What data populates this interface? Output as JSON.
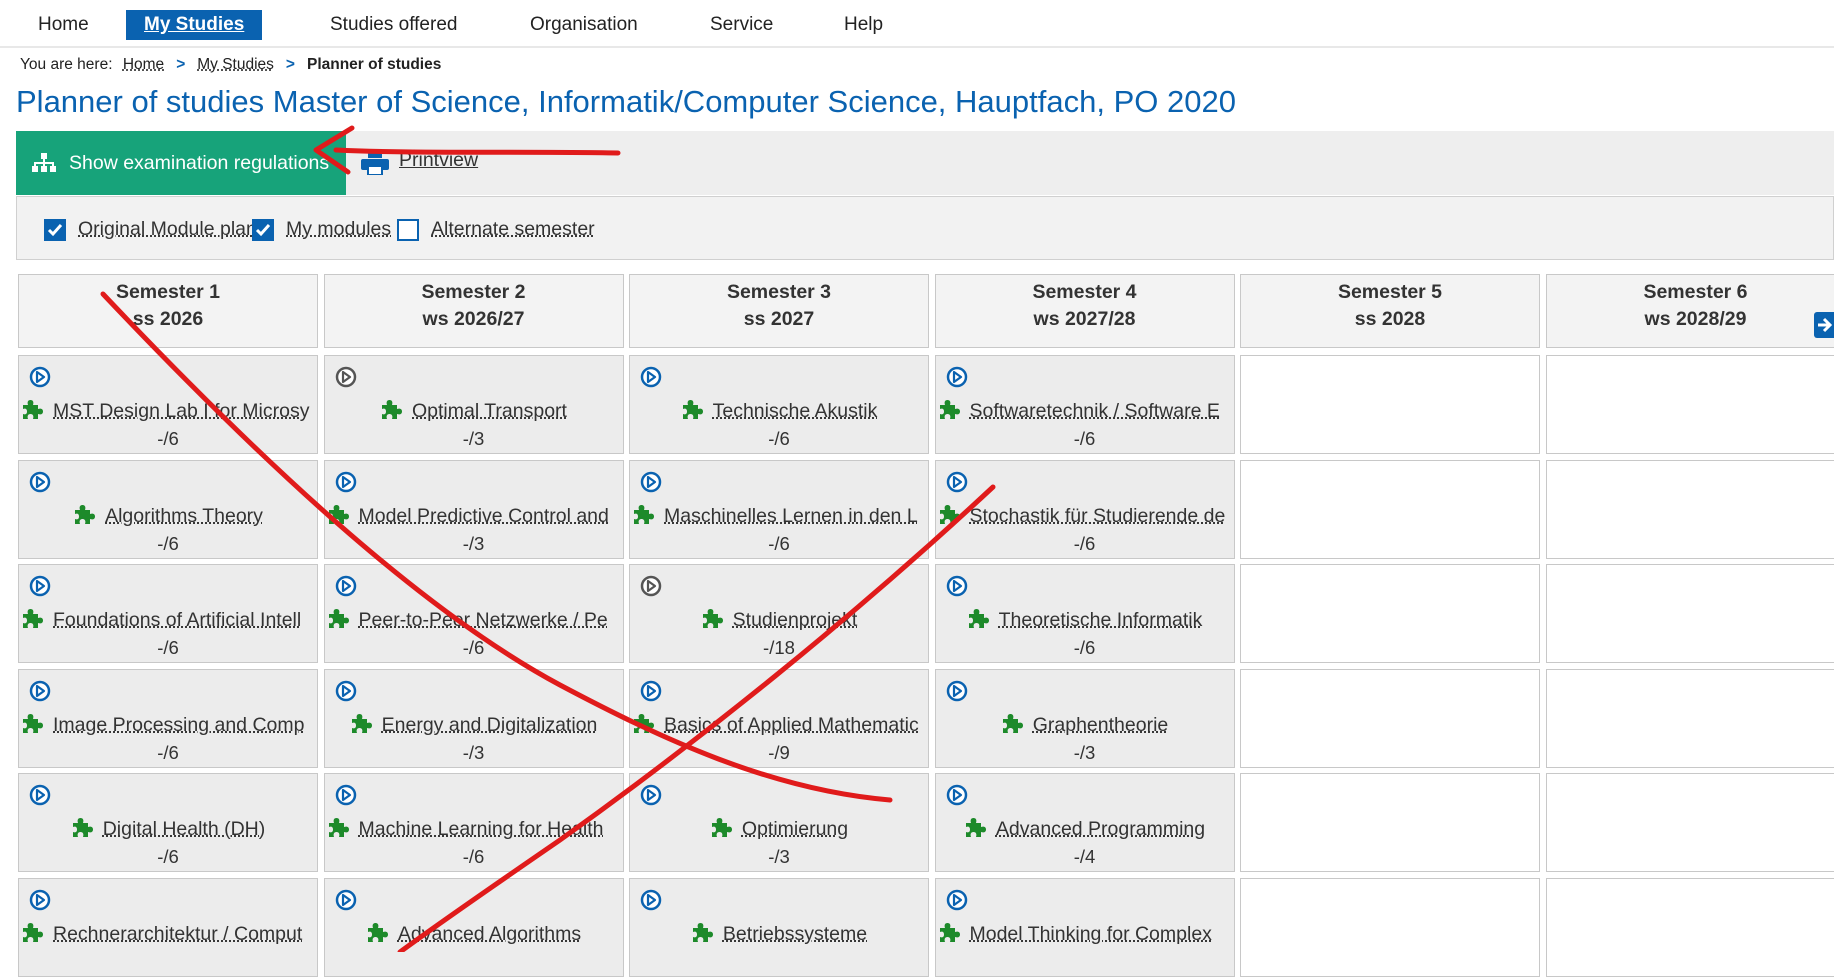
{
  "nav": {
    "items": [
      "Home",
      "My Studies",
      "Studies offered",
      "Organisation",
      "Service",
      "Help"
    ],
    "active_index": 1
  },
  "breadcrumb": {
    "prefix": "You are here:",
    "items": [
      "Home",
      "My Studies",
      "Planner of studies"
    ]
  },
  "title": "Planner of studies Master of Science, Informatik/Computer Science, Hauptfach, PO 2020",
  "toolbar": {
    "show_exam_label": "Show examination regulations",
    "printview_label": "Printview"
  },
  "filters": [
    {
      "label": "Original Module plan",
      "checked": true
    },
    {
      "label": "My modules",
      "checked": true
    },
    {
      "label": "Alternate semester",
      "checked": false
    }
  ],
  "semesters": [
    {
      "name": "Semester 1",
      "term": "ss 2026",
      "modules": [
        {
          "name": "MST Design Lab I for Microsy",
          "credits": "-/6",
          "icon": "blue"
        },
        {
          "name": "Algorithms Theory",
          "credits": "-/6",
          "icon": "blue"
        },
        {
          "name": "Foundations of Artificial Intell",
          "credits": "-/6",
          "icon": "blue"
        },
        {
          "name": "Image Processing and Comp",
          "credits": "-/6",
          "icon": "blue"
        },
        {
          "name": "Digital Health (DH)",
          "credits": "-/6",
          "icon": "blue"
        },
        {
          "name": "Rechnerarchitektur / Comput",
          "credits": "",
          "icon": "blue"
        }
      ]
    },
    {
      "name": "Semester 2",
      "term": "ws 2026/27",
      "modules": [
        {
          "name": "Optimal Transport",
          "credits": "-/3",
          "icon": "grey"
        },
        {
          "name": "Model Predictive Control and",
          "credits": "-/3",
          "icon": "blue"
        },
        {
          "name": "Peer-to-Peer Netzwerke / Pe",
          "credits": "-/6",
          "icon": "blue"
        },
        {
          "name": "Energy and Digitalization",
          "credits": "-/3",
          "icon": "blue"
        },
        {
          "name": "Machine Learning for Health",
          "credits": "-/6",
          "icon": "blue"
        },
        {
          "name": "Advanced Algorithms",
          "credits": "",
          "icon": "blue"
        }
      ]
    },
    {
      "name": "Semester 3",
      "term": "ss 2027",
      "modules": [
        {
          "name": "Technische Akustik",
          "credits": "-/6",
          "icon": "blue"
        },
        {
          "name": "Maschinelles Lernen in den L",
          "credits": "-/6",
          "icon": "blue"
        },
        {
          "name": "Studienprojekt",
          "credits": "-/18",
          "icon": "grey"
        },
        {
          "name": "Basics of Applied Mathematic",
          "credits": "-/9",
          "icon": "blue"
        },
        {
          "name": "Optimierung",
          "credits": "-/3",
          "icon": "blue"
        },
        {
          "name": "Betriebssysteme",
          "credits": "",
          "icon": "blue"
        }
      ]
    },
    {
      "name": "Semester 4",
      "term": "ws 2027/28",
      "modules": [
        {
          "name": "Softwaretechnik / Software E",
          "credits": "-/6",
          "icon": "blue"
        },
        {
          "name": "Stochastik für Studierende de",
          "credits": "-/6",
          "icon": "blue"
        },
        {
          "name": "Theoretische Informatik",
          "credits": "-/6",
          "icon": "blue"
        },
        {
          "name": "Graphentheorie",
          "credits": "-/3",
          "icon": "blue"
        },
        {
          "name": "Advanced Programming",
          "credits": "-/4",
          "icon": "blue"
        },
        {
          "name": "Model Thinking for Complex",
          "credits": "",
          "icon": "blue"
        }
      ]
    },
    {
      "name": "Semester 5",
      "term": "ss 2028",
      "modules": []
    },
    {
      "name": "Semester 6",
      "term": "ws 2028/29",
      "modules": []
    }
  ],
  "colors": {
    "brand_blue": "#0a62b0",
    "button_green": "#17a37a",
    "puzzle_green": "#1d8a2a",
    "annotation_red": "#e01b1b"
  }
}
